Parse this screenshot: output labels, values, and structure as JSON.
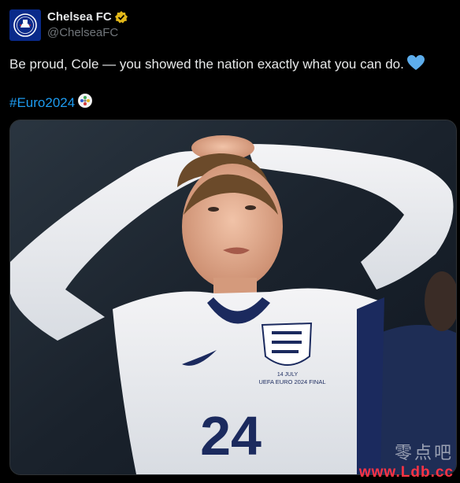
{
  "post": {
    "author": {
      "display_name": "Chelsea FC",
      "handle": "@ChelseaFC",
      "avatar_icon": "chelsea-crest-icon",
      "verified_icon": "gold-verified-badge-icon",
      "verified_color": "#e2b719"
    },
    "text": "Be proud, Cole — you showed the nation exactly what you can do.",
    "text_emoji_icon": "blue-heart-icon",
    "hashtag": "#Euro2024",
    "hashtag_emoji_icon": "euro2024-trophy-icon",
    "media": {
      "subject": "Player in white England shirt with hands on head",
      "shirt_number": "24",
      "shirt_text": "UEFA EURO 2024 FINAL",
      "shirt_text_top": "14 JULY"
    }
  },
  "watermark": {
    "chinese_text": "零点吧",
    "url_text": "www.Ldb.cc"
  },
  "colors": {
    "background": "#000000",
    "text_primary": "#e7e9ea",
    "text_secondary": "#71767b",
    "link": "#1d9bf0",
    "chelsea_blue": "#0a2a8a"
  }
}
